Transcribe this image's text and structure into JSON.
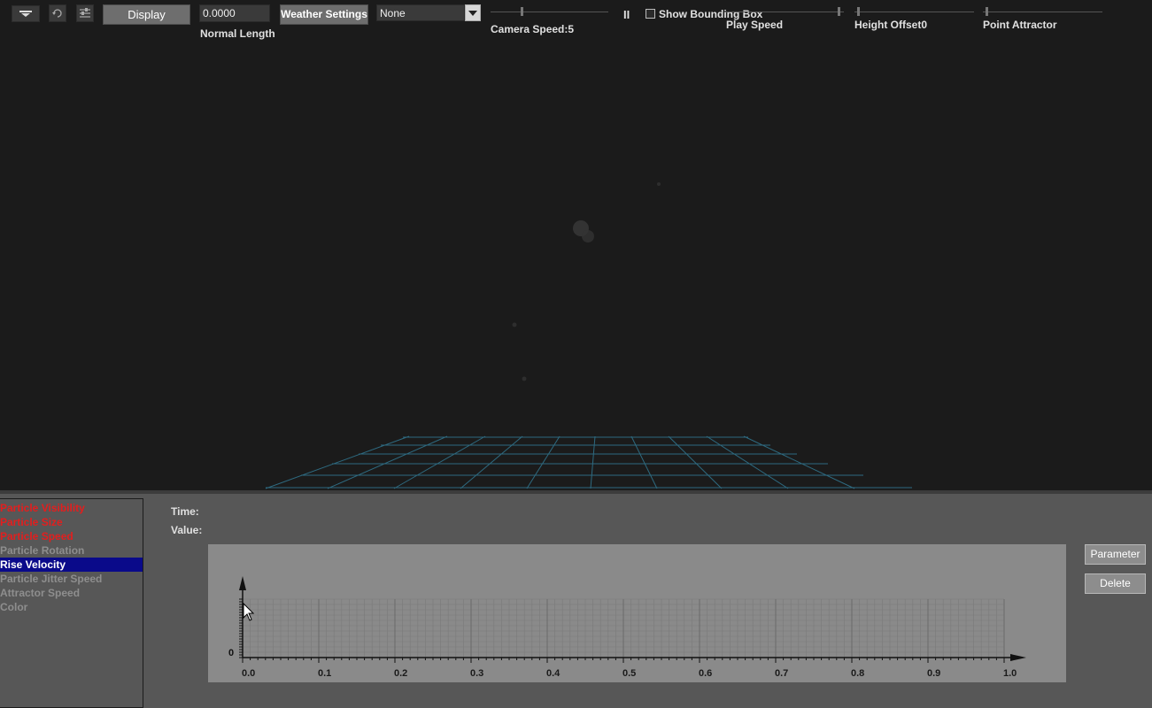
{
  "toolbar": {
    "display_label": "Display",
    "normal_length_value": "0.0000",
    "normal_length_label": "Normal Length",
    "weather_settings_label": "Weather Settings",
    "dropdown_value": "None",
    "camera_speed_label": "Camera Speed:5",
    "pause_symbol": "II",
    "show_bounding_box_label": "Show Bounding Box",
    "play_speed_label": "Play Speed",
    "height_offset_label": "Height Offset0",
    "point_attractor_label": "Point Attractor"
  },
  "parameters": {
    "items": [
      {
        "label": "Particle Visibility",
        "state": "red"
      },
      {
        "label": "Particle Size",
        "state": "red"
      },
      {
        "label": "Particle Speed",
        "state": "red"
      },
      {
        "label": "Particle Rotation",
        "state": "grey"
      },
      {
        "label": "Rise Velocity",
        "state": "selected"
      },
      {
        "label": "Particle Jitter Speed",
        "state": "grey"
      },
      {
        "label": "Attractor Speed",
        "state": "grey"
      },
      {
        "label": "Color",
        "state": "grey"
      }
    ]
  },
  "curve_editor": {
    "time_label": "Time:",
    "value_label": "Value:",
    "parameter_button": "Parameter",
    "delete_button": "Delete",
    "y_zero_label": "0",
    "x_ticks": [
      "0.0",
      "0.1",
      "0.2",
      "0.3",
      "0.4",
      "0.5",
      "0.6",
      "0.7",
      "0.8",
      "0.9",
      "1.0"
    ]
  },
  "colors": {
    "viewport_bg": "#1b1b1b",
    "panel_bg": "#575757",
    "grid_line": "#2e6a80",
    "selected_bg": "#0a0a8a",
    "active_param": "#e31e1e",
    "inactive_param": "#8e8e8e"
  }
}
